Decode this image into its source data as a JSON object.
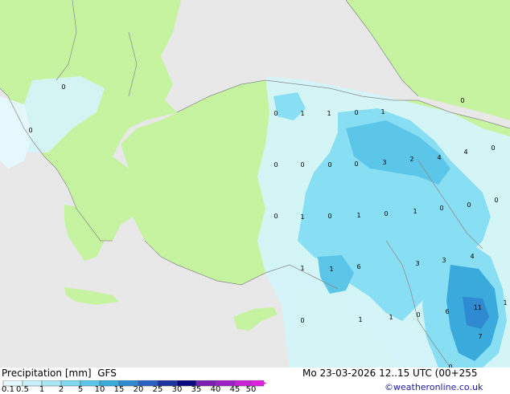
{
  "footer": {
    "title": "Precipitation [mm]",
    "model": "GFS",
    "datetime": "Mo 23-03-2026 12..15 UTC (00+255",
    "credit": "©weatheronline.co.uk"
  },
  "legend": {
    "ticks": [
      "0.1",
      "0.5",
      "1",
      "2",
      "5",
      "10",
      "15",
      "20",
      "25",
      "30",
      "35",
      "40",
      "45",
      "50"
    ],
    "colors": [
      "#e6f8ff",
      "#c8f0fb",
      "#a8e6f5",
      "#7fd8ef",
      "#5cc6e8",
      "#3aa9dc",
      "#2f8ad2",
      "#2c62c4",
      "#1c34a2",
      "#0a0a80",
      "#7a1fb2",
      "#a020c8",
      "#c822d8",
      "#e022e0"
    ]
  },
  "colors": {
    "land": "#c6f3a0",
    "sea_unaffected": "#e8e8e8",
    "precip_light": "#d4f4fb",
    "precip_mid": "#88def2",
    "precip_heavy": "#3aa9dc",
    "border_line": "#8a8a8a"
  },
  "map_labels": [
    {
      "t": "0"
    },
    {
      "t": "0"
    },
    {
      "t": "0"
    },
    {
      "t": "1"
    },
    {
      "t": "1"
    },
    {
      "t": "0"
    },
    {
      "t": "1"
    },
    {
      "t": "0"
    },
    {
      "t": "0"
    },
    {
      "t": "0"
    },
    {
      "t": "0"
    },
    {
      "t": "0"
    },
    {
      "t": "3"
    },
    {
      "t": "2"
    },
    {
      "t": "4"
    },
    {
      "t": "4"
    },
    {
      "t": "0"
    },
    {
      "t": "0"
    },
    {
      "t": "1"
    },
    {
      "t": "0"
    },
    {
      "t": "1"
    },
    {
      "t": "0"
    },
    {
      "t": "1"
    },
    {
      "t": "0"
    },
    {
      "t": "0"
    },
    {
      "t": "0"
    },
    {
      "t": "1"
    },
    {
      "t": "1"
    },
    {
      "t": "6"
    },
    {
      "t": "3"
    },
    {
      "t": "3"
    },
    {
      "t": "4"
    },
    {
      "t": "1"
    },
    {
      "t": "0"
    },
    {
      "t": "1"
    },
    {
      "t": "1"
    },
    {
      "t": "0"
    },
    {
      "t": "6"
    },
    {
      "t": "11"
    },
    {
      "t": "0"
    },
    {
      "t": "7"
    }
  ]
}
